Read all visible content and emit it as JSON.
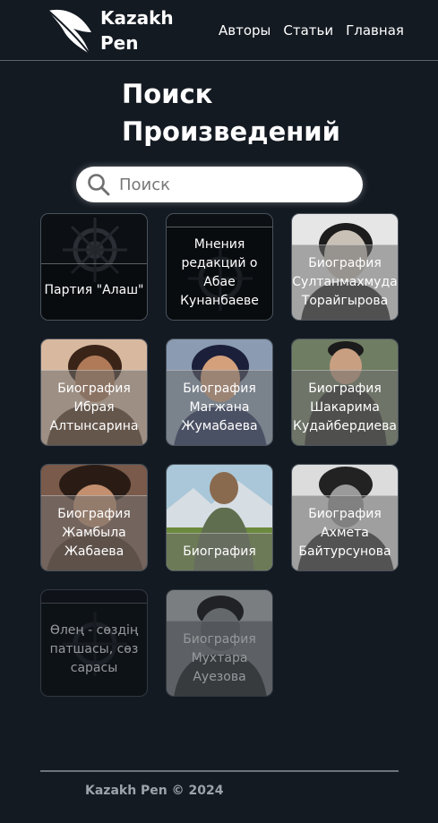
{
  "header": {
    "brand": "Kazakh Pen",
    "nav": [
      {
        "label": "Авторы"
      },
      {
        "label": "Статьи"
      },
      {
        "label": "Главная"
      }
    ]
  },
  "page": {
    "title": "Поиск Произведений"
  },
  "search": {
    "placeholder": "Поиск",
    "value": ""
  },
  "cards": [
    {
      "label": "Партия \"Алаш\""
    },
    {
      "label": "Мнения редакций о Абае Кунанбаеве"
    },
    {
      "label": "Биография Султанмахмуда Торайгырова"
    },
    {
      "label": "Биография Ибрая Алтынсарина"
    },
    {
      "label": "Биография Магжана Жумабаева"
    },
    {
      "label": "Биография Шакарима Кудайбердиева"
    },
    {
      "label": "Биография Жамбыла Жабаева"
    },
    {
      "label": "Биография"
    },
    {
      "label": "Биография Ахмета Байтурсунова"
    },
    {
      "label": "Өлең - сөздің патшасы, сөз сарасы"
    },
    {
      "label": "Биография Мухтара Ауезова"
    }
  ],
  "footer": {
    "text": "Kazakh Pen © 2024"
  }
}
